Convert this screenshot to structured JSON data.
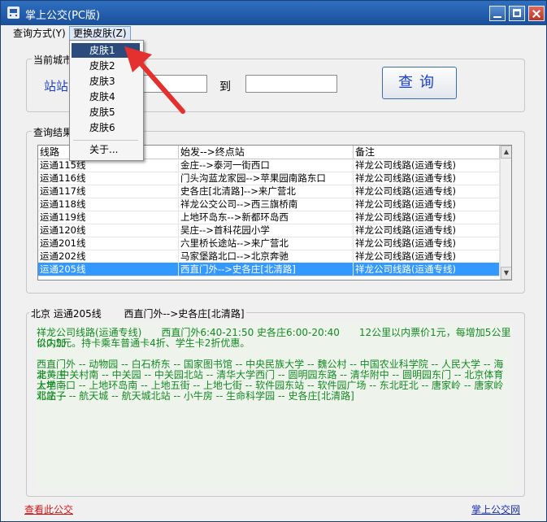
{
  "window": {
    "title": "掌上公交(PC版)"
  },
  "menu": {
    "items": [
      "查询方式(Y)",
      "更换皮肤(Z)"
    ]
  },
  "skin_menu": {
    "items": [
      "皮肤1",
      "皮肤2",
      "皮肤3",
      "皮肤4",
      "皮肤5",
      "皮肤6"
    ],
    "about": "关于..."
  },
  "city_group": {
    "label": "当前城市",
    "station_label": "站站",
    "to_label": "到",
    "from_value": "",
    "to_value": "",
    "query_button": "查询"
  },
  "results": {
    "label": "查询结果",
    "columns": [
      "线路",
      "始发-->终点站",
      "备注"
    ],
    "rows": [
      [
        "运通115线",
        "金庄-->泰河一街西口",
        "祥龙公司线路(运通专线)"
      ],
      [
        "运通116线",
        "门头沟蓝龙家园-->苹果园南路东口",
        "祥龙公司线路(运通专线)"
      ],
      [
        "运通117线",
        "史各庄[北清路]-->来广营北",
        "祥龙公司线路(运通专线)"
      ],
      [
        "运通118线",
        "祥龙公交公司-->西三旗桥南",
        "祥龙公司线路(运通专线)"
      ],
      [
        "运通119线",
        "上地环岛东-->新都环岛西",
        "祥龙公司线路(运通专线)"
      ],
      [
        "运通120线",
        "吴庄-->首科花园小学",
        "祥龙公司线路(运通专线)"
      ],
      [
        "运通201线",
        "六里桥长途站-->来广营北",
        "祥龙公司线路(运通专线)"
      ],
      [
        "运通202线",
        "马家堡路北口-->北京奔驰",
        "祥龙公司线路(运通专线)"
      ],
      [
        "运通205线",
        "西直门外-->史各庄[北清路]",
        "祥龙公司线路(运通专线)"
      ]
    ],
    "selected_index": 8
  },
  "detail": {
    "label": "北京 运通205线 　　西直门外-->史各庄[北清路]",
    "line1": "祥龙公司线路(运通专线)　　西直门外6:40-21:50 史各庄6:00-20:40　　12公里以内票价1元，每增加5公里以内加",
    "line2": "价0.5元。持卡乘车普通卡4折、学生卡2折优惠。",
    "line3": "西直门外 -- 动物园 -- 白石桥东 -- 国家图书馆 -- 中央民族大学 -- 魏公村 -- 中国农业科学院 -- 人民大学 -- 海淀黄庄",
    "line4": "北 -- 中关村南 -- 中关园 -- 中关园北站 -- 清华大学西门 -- 圆明园东路 -- 清华附中 -- 圆明园东门 -- 北京体育大学 --",
    "line5": "上地南口 -- 上地环岛南 -- 上地五街 -- 上地七街 -- 软件园东站 -- 软件园广场 -- 东北旺北 -- 唐家岭 -- 唐家岭北站 --",
    "line6": "邓庄子 -- 航天城 -- 航天城北站 -- 小牛房 -- 生命科学园 -- 史各庄[北清路]"
  },
  "footer": {
    "left_link": "查看此公交",
    "right_link": "掌上公交网"
  },
  "colors": {
    "selection": "#3399ff",
    "route_text": "#138a22",
    "highlight_menu": "#2a4b7c",
    "arrow": "#e53030"
  }
}
